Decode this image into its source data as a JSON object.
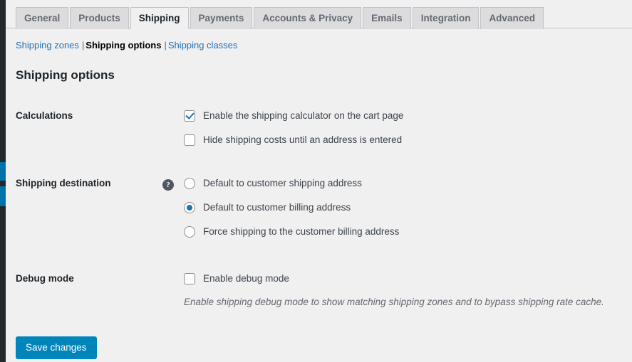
{
  "colors": {
    "accent_blue": "#2271b1",
    "link_blue": "#2271b1",
    "button_blue": "#0085ba",
    "admin_menu_dark": "#23282d",
    "admin_menu_current": "#0073aa",
    "page_background": "#f0f0f1",
    "tab_inactive": "#dcdcde",
    "border": "#c3c4c7",
    "text_dark": "#1d2327",
    "text_muted": "#646970"
  },
  "nav_tabs": [
    {
      "label": "General",
      "active": false
    },
    {
      "label": "Products",
      "active": false
    },
    {
      "label": "Shipping",
      "active": true
    },
    {
      "label": "Payments",
      "active": false
    },
    {
      "label": "Accounts & Privacy",
      "active": false
    },
    {
      "label": "Emails",
      "active": false
    },
    {
      "label": "Integration",
      "active": false
    },
    {
      "label": "Advanced",
      "active": false
    }
  ],
  "subnav": {
    "items": [
      {
        "label": "Shipping zones",
        "current": false
      },
      {
        "label": "Shipping options",
        "current": true
      },
      {
        "label": "Shipping classes",
        "current": false
      }
    ],
    "separator": "|"
  },
  "section": {
    "title": "Shipping options"
  },
  "rows": {
    "calculations": {
      "label": "Calculations",
      "options": [
        {
          "type": "checkbox",
          "label": "Enable the shipping calculator on the cart page",
          "checked": true
        },
        {
          "type": "checkbox",
          "label": "Hide shipping costs until an address is entered",
          "checked": false
        }
      ]
    },
    "shipping_destination": {
      "label": "Shipping destination",
      "help_icon": "help-question-icon",
      "help_glyph": "?",
      "options": [
        {
          "type": "radio",
          "label": "Default to customer shipping address",
          "checked": false
        },
        {
          "type": "radio",
          "label": "Default to customer billing address",
          "checked": true
        },
        {
          "type": "radio",
          "label": "Force shipping to the customer billing address",
          "checked": false
        }
      ]
    },
    "debug_mode": {
      "label": "Debug mode",
      "options": [
        {
          "type": "checkbox",
          "label": "Enable debug mode",
          "checked": false
        }
      ],
      "description": "Enable shipping debug mode to show matching shipping zones and to bypass shipping rate cache."
    }
  },
  "submit": {
    "save_label": "Save changes"
  }
}
